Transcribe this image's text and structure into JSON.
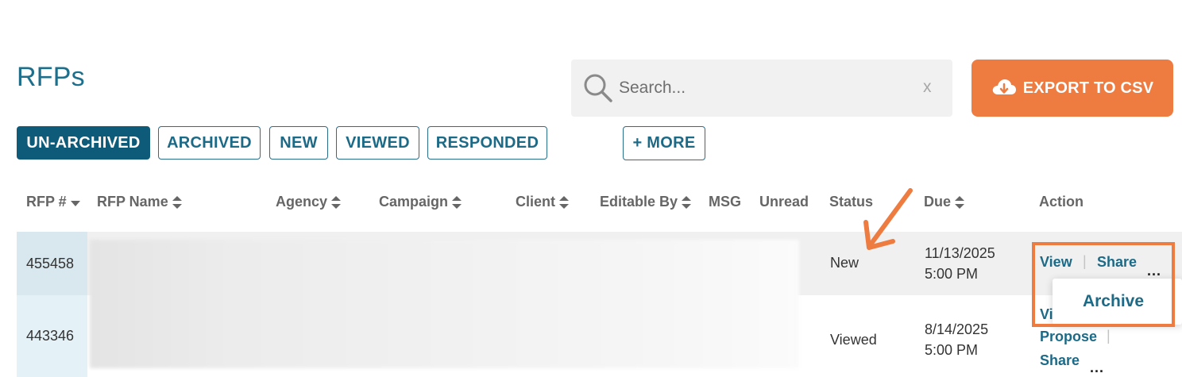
{
  "page": {
    "title": "RFPs"
  },
  "search": {
    "placeholder": "Search...",
    "clear": "x"
  },
  "export": {
    "label": "EXPORT TO CSV"
  },
  "filters": [
    {
      "label": "UN-ARCHIVED",
      "active": true
    },
    {
      "label": "ARCHIVED",
      "active": false
    },
    {
      "label": "NEW",
      "active": false
    },
    {
      "label": "VIEWED",
      "active": false
    },
    {
      "label": "RESPONDED",
      "active": false
    },
    {
      "label": "+ MORE",
      "active": false
    }
  ],
  "columns": [
    {
      "label": "RFP #",
      "sort": "desc"
    },
    {
      "label": "RFP Name",
      "sort": "both"
    },
    {
      "label": "Agency",
      "sort": "both"
    },
    {
      "label": "Campaign",
      "sort": "both"
    },
    {
      "label": "Client",
      "sort": "both"
    },
    {
      "label": "Editable By",
      "sort": "both"
    },
    {
      "label": "MSG",
      "sort": "none"
    },
    {
      "label": "Unread",
      "sort": "none"
    },
    {
      "label": "Status",
      "sort": "none"
    },
    {
      "label": "Due",
      "sort": "both"
    },
    {
      "label": "Action",
      "sort": "none"
    }
  ],
  "rows": [
    {
      "id": "455458",
      "status": "New",
      "due_date": "11/13/2025",
      "due_time": "5:00 PM",
      "actions": {
        "view": "View",
        "share": "Share",
        "more": "..."
      }
    },
    {
      "id": "443346",
      "status": "Viewed",
      "due_date": "8/14/2025",
      "due_time": "5:00 PM",
      "actions": {
        "view_partial": "Vi",
        "propose": "Propose",
        "share": "Share",
        "more": "..."
      }
    }
  ],
  "dropdown": {
    "archive": "Archive"
  },
  "colors": {
    "title": "#1d6f8c",
    "primary": "#0e5a79",
    "link": "#1d6a87",
    "accent": "#ee7b40",
    "row_highlight": "#f0f0f0",
    "id_cell": "#d9e8ee"
  },
  "icons": {
    "search": "search-icon",
    "export": "cloud-download-icon",
    "sort": "sort-icon",
    "sort_desc": "caret-down-icon",
    "annotation": "arrow-icon"
  }
}
